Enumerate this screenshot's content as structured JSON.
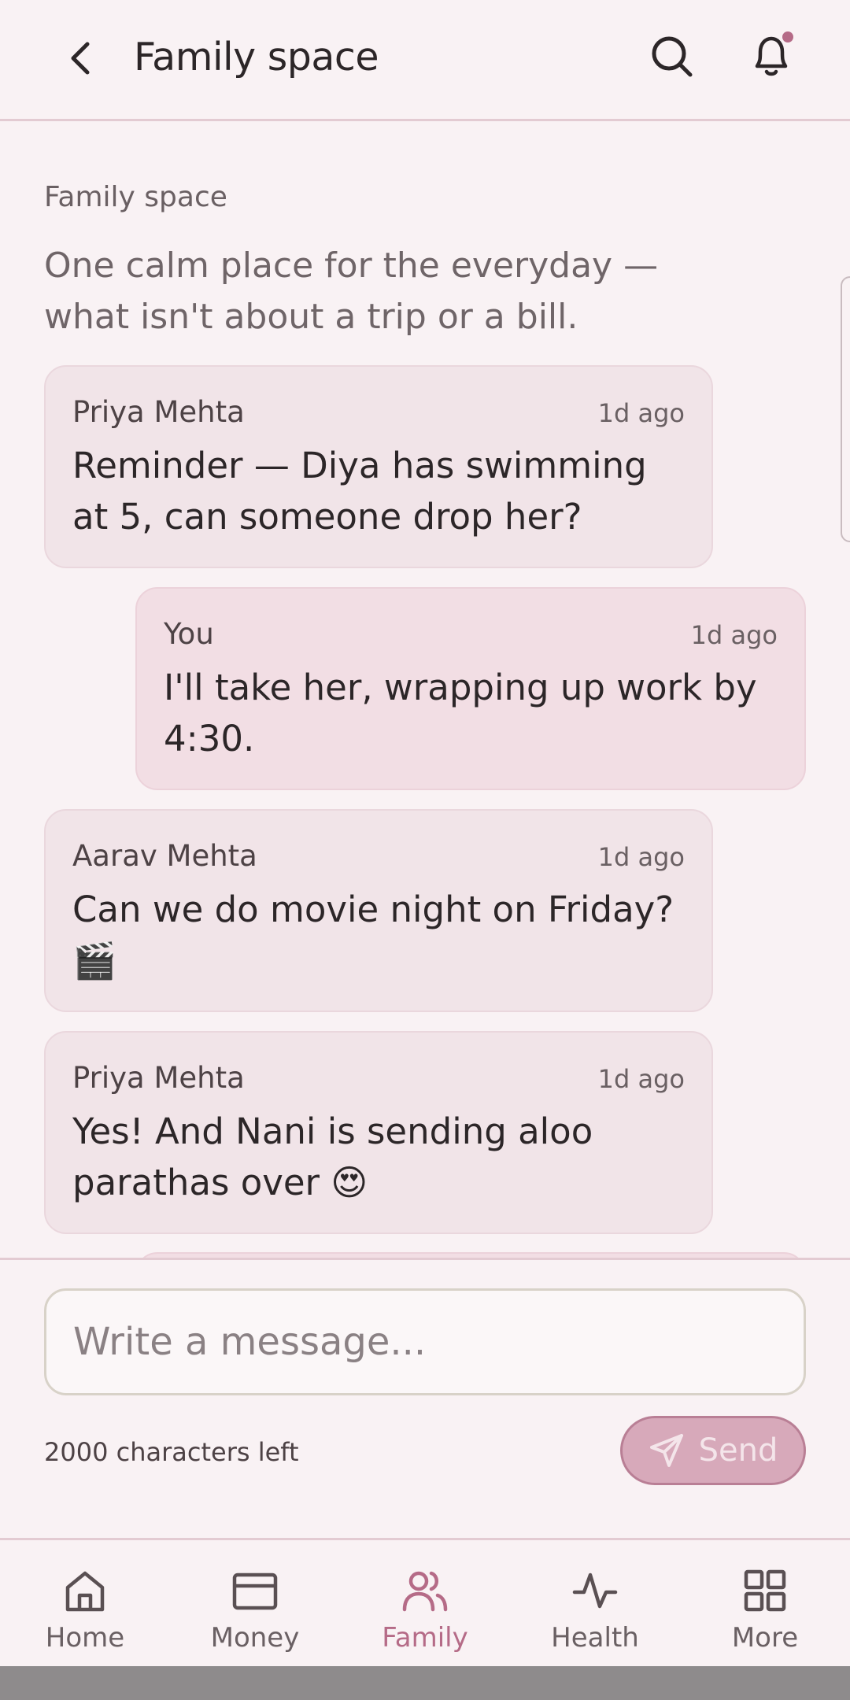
{
  "header": {
    "title": "Family space"
  },
  "intro": {
    "label": "Family space",
    "description": "One calm place for the everyday — what isn't about a trip or a bill."
  },
  "messages": [
    {
      "author": "Priya Mehta",
      "time": "1d ago",
      "text": "Reminder — Diya has swimming at 5, can someone drop her?",
      "mine": false
    },
    {
      "author": "You",
      "time": "1d ago",
      "text": "I'll take her, wrapping up work by 4:30.",
      "mine": true
    },
    {
      "author": "Aarav Mehta",
      "time": "1d ago",
      "text": "Can we do movie night on Friday? 🎬",
      "mine": false
    },
    {
      "author": "Priya Mehta",
      "time": "1d ago",
      "text": "Yes! And Nani is sending aloo parathas over 😍",
      "mine": false
    }
  ],
  "composer": {
    "placeholder": "Write a message...",
    "chars_left": "2000 characters left",
    "send_label": "Send"
  },
  "nav": {
    "items": [
      {
        "label": "Home",
        "icon": "home-icon",
        "active": false
      },
      {
        "label": "Money",
        "icon": "card-icon",
        "active": false
      },
      {
        "label": "Family",
        "icon": "people-icon",
        "active": true
      },
      {
        "label": "Health",
        "icon": "pulse-icon",
        "active": false
      },
      {
        "label": "More",
        "icon": "grid-icon",
        "active": false
      }
    ]
  },
  "colors": {
    "background": "#f9f2f4",
    "accent": "#b56b87",
    "bubble": "#f1e4e8",
    "send_button": "#d7a9ba"
  }
}
